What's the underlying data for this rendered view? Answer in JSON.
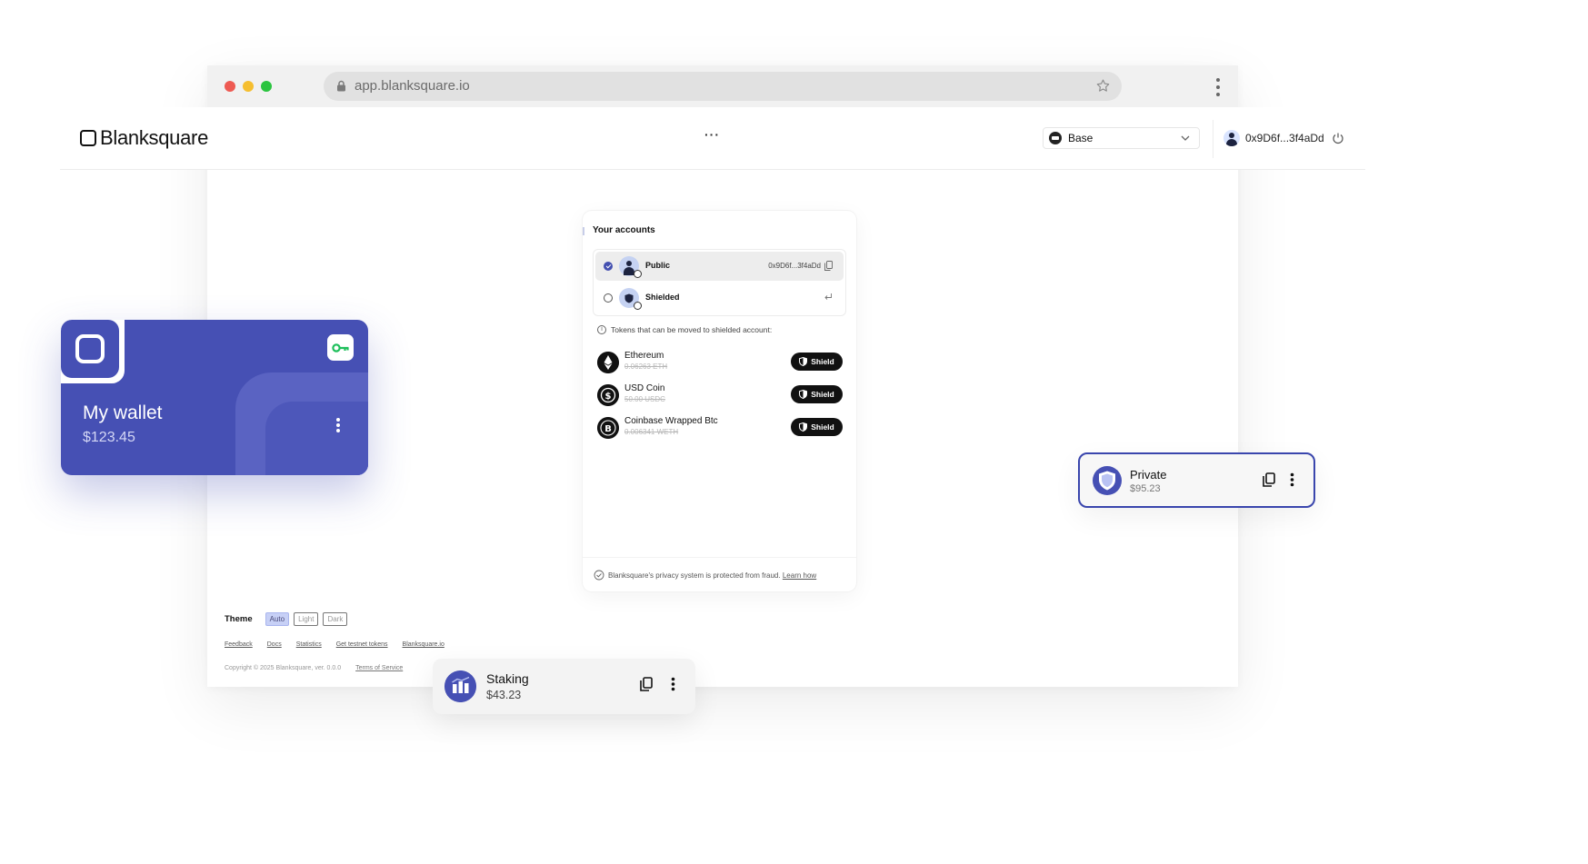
{
  "browser": {
    "url": "app.blanksquare.io"
  },
  "header": {
    "brand": "Blanksquare",
    "more_label": "···",
    "network": "Base",
    "account_address": "0x9D6f...3f4aDd"
  },
  "panel": {
    "title": "Your accounts",
    "accounts": [
      {
        "name": "Public",
        "address": "0x9D6f...3f4aDd",
        "selected": true
      },
      {
        "name": "Shielded",
        "address": "",
        "selected": false
      }
    ],
    "tokens_info": "Tokens that can be moved to shielded account:",
    "tokens": [
      {
        "name": "Ethereum",
        "amount": "0.06263 ETH",
        "action": "Shield",
        "icon": "ethereum-icon"
      },
      {
        "name": "USD Coin",
        "amount": "50.00 USDC",
        "action": "Shield",
        "icon": "usdc-icon"
      },
      {
        "name": "Coinbase Wrapped Btc",
        "amount": "0.006341 WETH",
        "action": "Shield",
        "icon": "bitcoin-icon"
      }
    ],
    "footer_text": "Blanksquare's privacy system is protected from fraud.",
    "footer_link": "Learn how"
  },
  "footer": {
    "theme_label": "Theme",
    "theme_options": [
      "Auto",
      "Light",
      "Dark"
    ],
    "theme_selected": "Auto",
    "links": [
      "Feedback",
      "Docs",
      "Statistics",
      "Get testnet tokens",
      "Blanksquare.io"
    ],
    "copyright": "Copyright © 2025 Blanksquare, ver. 0.0.0",
    "terms": "Terms of Service"
  },
  "wallet_card": {
    "name": "My wallet",
    "balance": "$123.45"
  },
  "private_card": {
    "name": "Private",
    "balance": "$95.23"
  },
  "staking_card": {
    "name": "Staking",
    "balance": "$43.23"
  },
  "colors": {
    "brand": "#4650b4",
    "key_accent": "#1fbf5c"
  }
}
